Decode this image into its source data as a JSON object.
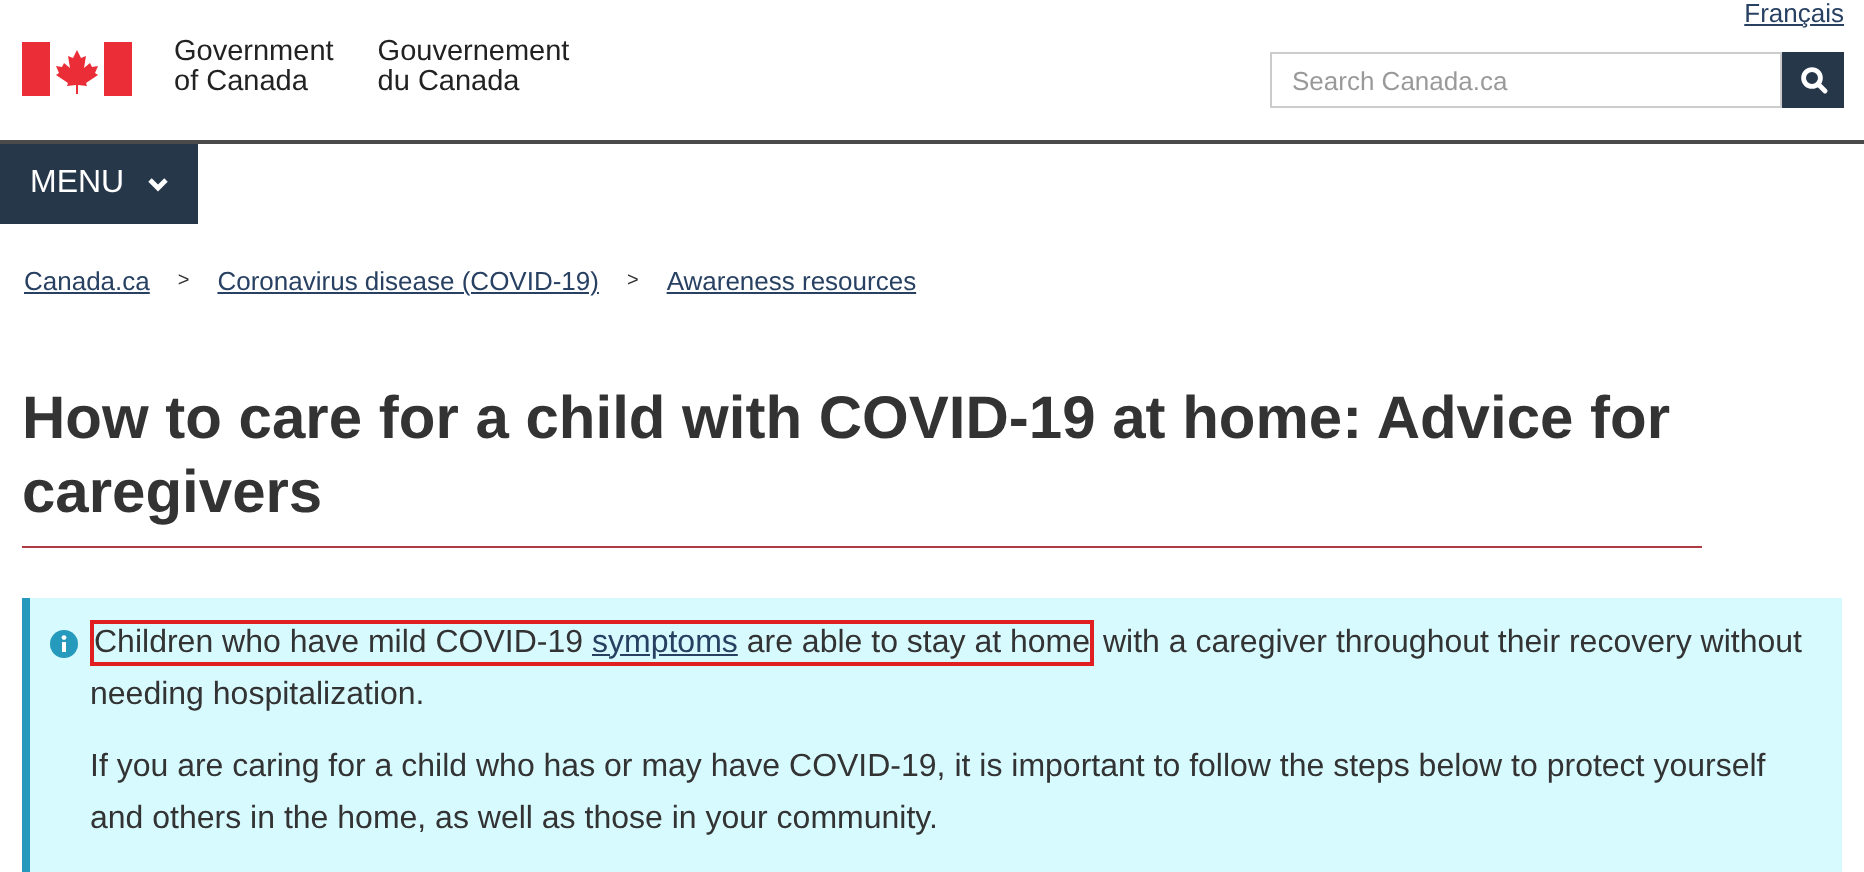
{
  "header": {
    "language_link": "Français",
    "wordmark_en": [
      "Government",
      "of Canada"
    ],
    "wordmark_fr": [
      "Gouvernement",
      "du Canada"
    ],
    "search": {
      "placeholder": "Search Canada.ca"
    }
  },
  "menu_button": {
    "label": "MENU"
  },
  "breadcrumbs": [
    {
      "label": "Canada.ca"
    },
    {
      "label": "Coronavirus disease (COVID-19)"
    },
    {
      "label": "Awareness resources"
    }
  ],
  "breadcrumb_separator": ">",
  "title": "How to care for a child with COVID-19 at home: Advice for caregivers",
  "alert": {
    "paragraphs": [
      [
        {
          "kind": "text",
          "text": "Children who have mild COVID-19 ",
          "highlighted": true
        },
        {
          "kind": "link",
          "text": "symptoms",
          "highlighted": true
        },
        {
          "kind": "text",
          "text": " are able to stay at home",
          "highlighted": true
        },
        {
          "kind": "text",
          "text": " with a caregiver throughout their recovery without needing hospitalization.",
          "highlighted": false
        }
      ],
      [
        {
          "kind": "text",
          "text": "If you are caring for a child who has or may have COVID-19, it is important to follow the steps below to protect yourself and others in the home, as well as those in your community.",
          "highlighted": false
        }
      ]
    ]
  }
}
